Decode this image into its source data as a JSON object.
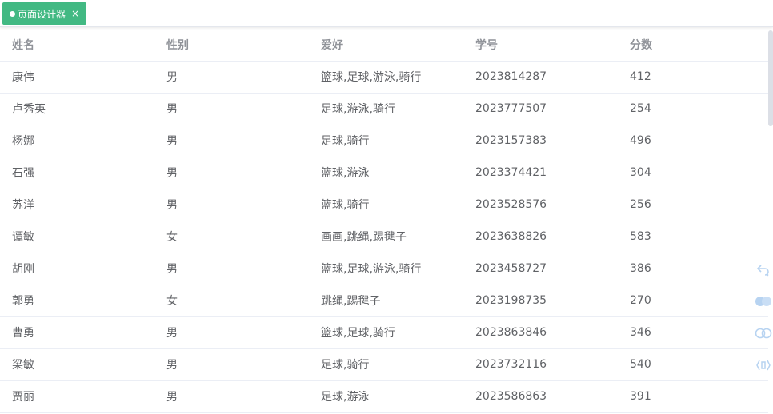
{
  "tab": {
    "label": "页面设计器",
    "close": "×"
  },
  "table": {
    "columns": [
      "姓名",
      "性别",
      "爱好",
      "学号",
      "分数"
    ],
    "rows": [
      [
        "康伟",
        "男",
        "篮球,足球,游泳,骑行",
        "2023814287",
        "412"
      ],
      [
        "卢秀英",
        "男",
        "足球,游泳,骑行",
        "2023777507",
        "254"
      ],
      [
        "杨娜",
        "男",
        "足球,骑行",
        "2023157383",
        "496"
      ],
      [
        "石强",
        "男",
        "篮球,游泳",
        "2023374421",
        "304"
      ],
      [
        "苏洋",
        "男",
        "篮球,骑行",
        "2023528576",
        "256"
      ],
      [
        "谭敏",
        "女",
        "画画,跳绳,踢毽子",
        "2023638826",
        "583"
      ],
      [
        "胡刚",
        "男",
        "篮球,足球,游泳,骑行",
        "2023458727",
        "386"
      ],
      [
        "郭勇",
        "女",
        "跳绳,踢毽子",
        "2023198735",
        "270"
      ],
      [
        "曹勇",
        "男",
        "篮球,足球,骑行",
        "2023863846",
        "346"
      ],
      [
        "梁敏",
        "男",
        "足球,骑行",
        "2023732116",
        "540"
      ],
      [
        "贾丽",
        "男",
        "足球,游泳",
        "2023586863",
        "391"
      ]
    ]
  },
  "side_tools": [
    "undo-icon",
    "double-circle-icon",
    "link-icon",
    "code-bracket-icon"
  ],
  "colors": {
    "accent": "#42b983",
    "header_text": "#909399",
    "body_text": "#606266",
    "border": "#ebeef5",
    "tool_icon": "#b7d3f1"
  }
}
